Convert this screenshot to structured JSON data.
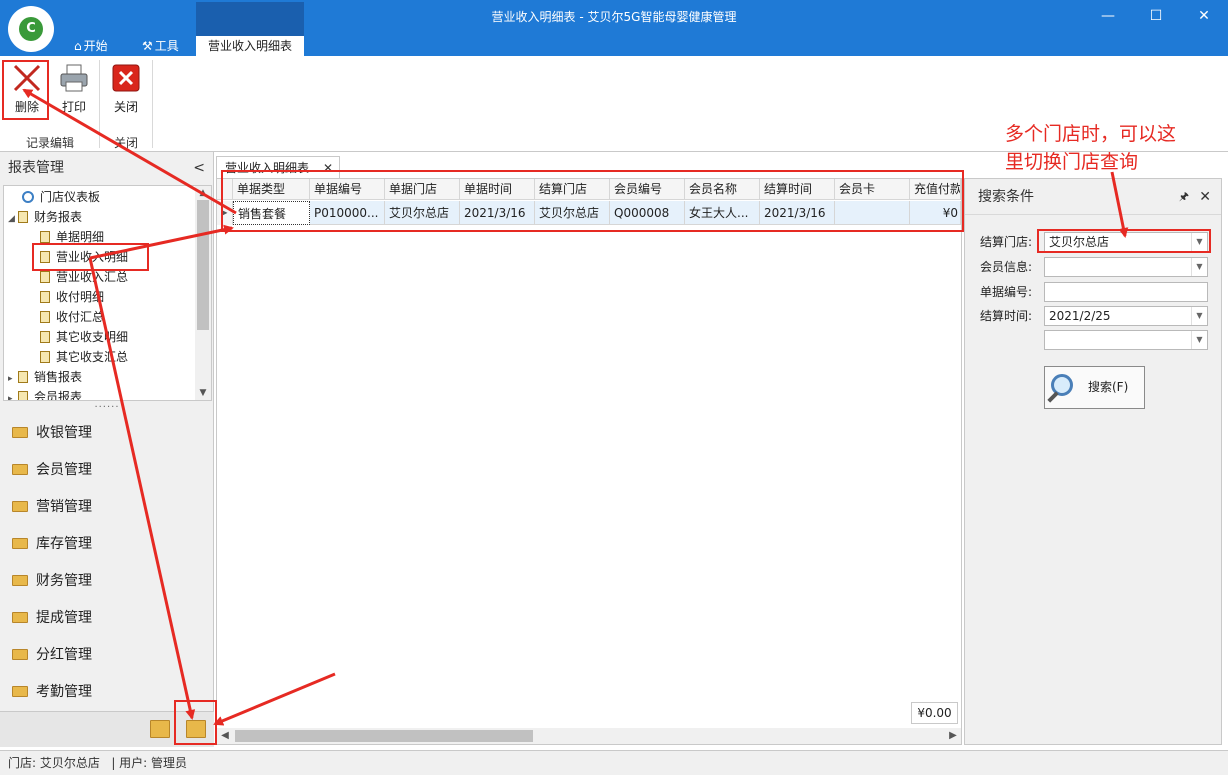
{
  "window": {
    "title": "营业收入明细表 - 艾贝尔5G智能母婴健康管理",
    "controls": {
      "minimize": "—",
      "maximize": "☐",
      "close": "✕"
    },
    "logo_text": "C"
  },
  "ribbon_tabs": [
    {
      "label": "开始",
      "icon": "home-icon"
    },
    {
      "label": "工具",
      "icon": "tools-icon"
    },
    {
      "label": "营业收入明细表",
      "icon": ""
    }
  ],
  "ribbon": {
    "buttons": [
      {
        "label": "删除",
        "icon": "delete-icon"
      },
      {
        "label": "打印",
        "icon": "printer-icon"
      },
      {
        "label": "关闭",
        "icon": "close-icon"
      }
    ],
    "groups": [
      "记录编辑",
      "关闭"
    ]
  },
  "left_pane": {
    "header": "报表管理",
    "collapse_glyph": "<",
    "tree": [
      {
        "label": "门店仪表板",
        "level": 1,
        "icon": "dashboard-icon"
      },
      {
        "label": "财务报表",
        "level": 1,
        "expanded": true,
        "icon": "report-icon"
      },
      {
        "label": "单据明细",
        "level": 2,
        "icon": "report-icon"
      },
      {
        "label": "营业收入明细",
        "level": 2,
        "icon": "report-icon",
        "selected": true
      },
      {
        "label": "营业收入汇总",
        "level": 2,
        "icon": "report-icon"
      },
      {
        "label": "收付明细",
        "level": 2,
        "icon": "report-icon"
      },
      {
        "label": "收付汇总",
        "level": 2,
        "icon": "report-icon"
      },
      {
        "label": "其它收支明细",
        "level": 2,
        "icon": "report-icon"
      },
      {
        "label": "其它收支汇总",
        "level": 2,
        "icon": "report-icon"
      },
      {
        "label": "销售报表",
        "level": 1,
        "collapsed": true,
        "icon": "report-icon"
      },
      {
        "label": "会员报表",
        "level": 1,
        "collapsed": true,
        "icon": "report-icon"
      }
    ],
    "dots": "······",
    "nav": [
      "收银管理",
      "会员管理",
      "营销管理",
      "库存管理",
      "财务管理",
      "提成管理",
      "分红管理",
      "考勤管理"
    ]
  },
  "doc_tab": {
    "label": "营业收入明细表",
    "close": "✕"
  },
  "grid": {
    "columns": [
      "单据类型",
      "单据编号",
      "单据门店",
      "单据时间",
      "结算门店",
      "会员编号",
      "会员名称",
      "结算时间",
      "会员卡",
      "充值付款"
    ],
    "rows": [
      [
        "销售套餐",
        "P010000...",
        "艾贝尔总店",
        "2021/3/16",
        "艾贝尔总店",
        "Q000008",
        "女王大人...",
        "2021/3/16",
        "",
        "¥0"
      ]
    ],
    "total": "¥0.00"
  },
  "search_panel": {
    "title": "搜索条件",
    "pin": "🖈",
    "close": "✕",
    "fields": [
      {
        "label": "结算门店:",
        "value": "艾贝尔总店",
        "dropdown": true
      },
      {
        "label": "会员信息:",
        "value": "",
        "dropdown": true
      },
      {
        "label": "单据编号:",
        "value": "",
        "dropdown": false
      },
      {
        "label": "结算时间:",
        "value": "2021/2/25",
        "dropdown": true
      },
      {
        "label": "",
        "value": "",
        "dropdown": true
      }
    ],
    "search_button": "搜索(F)"
  },
  "status": {
    "store_label": "门店: 艾贝尔总店",
    "user_label": "| 用户: 管理员"
  },
  "annotation": {
    "text": "多个门店时，可以这里切换门店查询",
    "line1": "多个门店时，可以这",
    "line2": "里切换门店查询",
    "color": "#e62a23"
  }
}
